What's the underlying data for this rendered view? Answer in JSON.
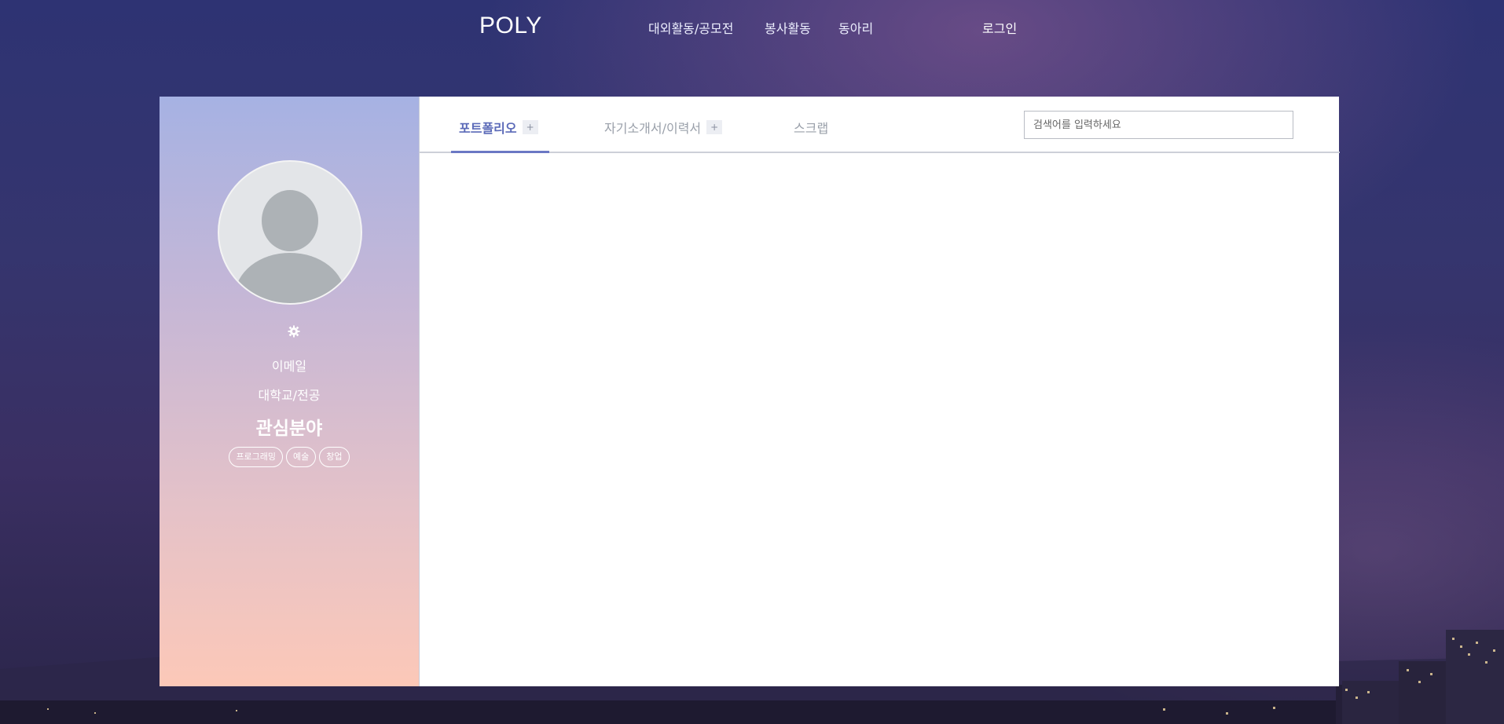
{
  "header": {
    "logo": "POLY",
    "nav": [
      "대외활동/공모전",
      "봉사활동",
      "동아리"
    ],
    "login": "로그인"
  },
  "profile": {
    "email": "이메일",
    "school": "대학교/전공",
    "interest_title": "관심분야",
    "interests": [
      "프로그래밍",
      "예술",
      "창업"
    ]
  },
  "tabs": [
    {
      "label": "포트폴리오",
      "plus": "+",
      "active": true
    },
    {
      "label": "자기소개서/이력서",
      "plus": "+",
      "active": false
    },
    {
      "label": "스크랩",
      "active": false
    }
  ],
  "search": {
    "placeholder": "검색어를 입력하세요"
  },
  "icons": {
    "settings": "gear-icon",
    "avatar": "user-avatar-icon"
  },
  "colors": {
    "accent": "#6b78c4"
  }
}
